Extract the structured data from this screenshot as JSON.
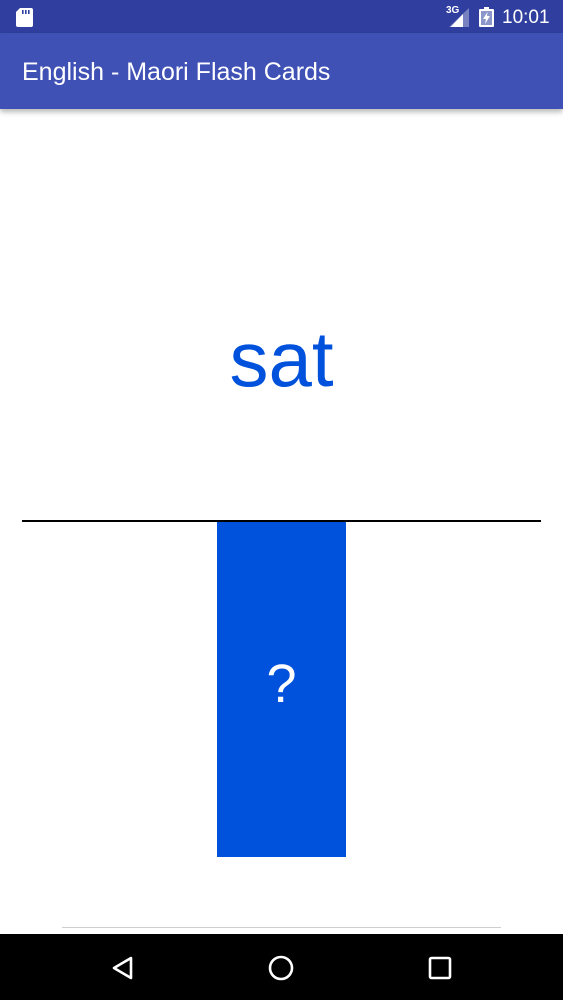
{
  "status_bar": {
    "network": "3G",
    "time": "10:01",
    "icons": [
      "sd-card-icon",
      "signal-icon",
      "battery-icon"
    ]
  },
  "app_bar": {
    "title": "English - Maori Flash Cards"
  },
  "card": {
    "word": "sat",
    "reveal_label": "?"
  },
  "nav_bar": {
    "buttons": [
      "back-icon",
      "home-icon",
      "recents-icon"
    ]
  },
  "colors": {
    "status_bar": "#303F9F",
    "app_bar": "#3F51B5",
    "accent": "#0052DC",
    "divider": "#000000"
  }
}
